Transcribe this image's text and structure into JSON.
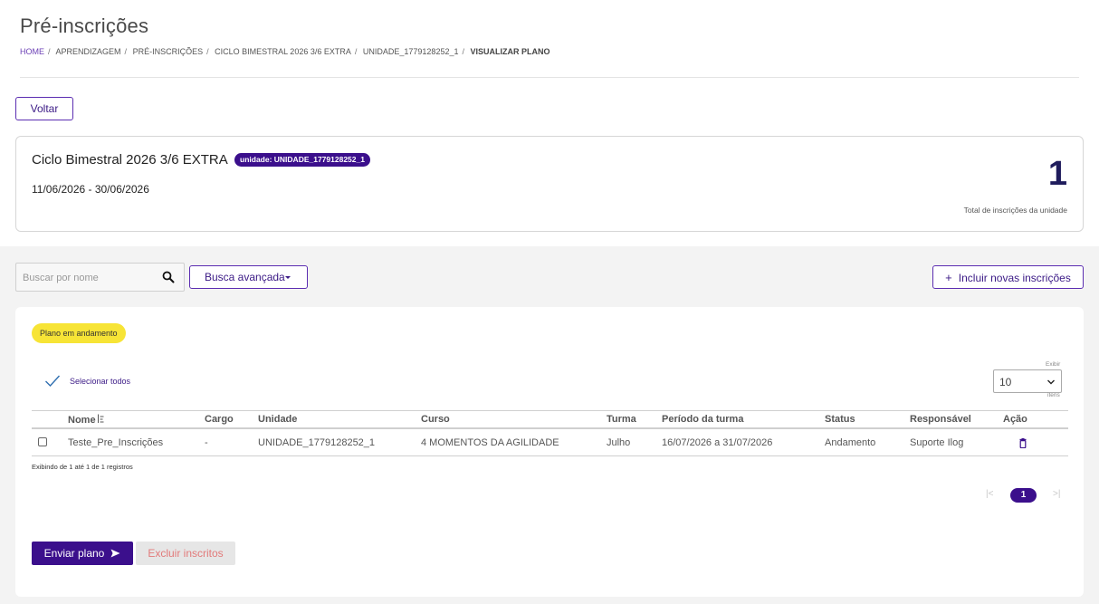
{
  "page": {
    "title": "Pré-inscrições"
  },
  "breadcrumb": [
    {
      "label": "HOME"
    },
    {
      "label": "APRENDIZAGEM"
    },
    {
      "label": "PRÉ-INSCRIÇÕES"
    },
    {
      "label": "CICLO BIMESTRAL 2026 3/6 EXTRA"
    },
    {
      "label": "UNIDADE_1779128252_1"
    },
    {
      "label": "VISUALIZAR PLANO"
    }
  ],
  "back_button": {
    "label": "Voltar"
  },
  "cycle": {
    "title": "Ciclo Bimestral 2026 3/6 EXTRA",
    "unit_badge": "unidade: UNIDADE_1779128252_1",
    "dates": "11/06/2026 - 30/06/2026",
    "total": "1",
    "total_label": "Total de inscrições da unidade"
  },
  "toolbar": {
    "search_placeholder": "Buscar por nome",
    "advanced_search_label": "Busca avançada",
    "add_label": "Incluir novas inscrições",
    "add_icon": "+"
  },
  "plan": {
    "status_badge": "Plano em andamento",
    "select_all_label": "Selecionar todos",
    "page_size_label_top": "Exibir",
    "page_size_value": "10",
    "page_size_label_bottom": "itens"
  },
  "table": {
    "columns": [
      "Nome",
      "Cargo",
      "Unidade",
      "Curso",
      "Turma",
      "Período da turma",
      "Status",
      "Responsável",
      "Ação"
    ],
    "rows": [
      {
        "nome": "Teste_Pre_Inscrições",
        "cargo": "-",
        "unidade": "UNIDADE_1779128252_1",
        "curso": "4 MOMENTOS DA AGILIDADE",
        "turma": "Julho",
        "periodo": "16/07/2026 a 31/07/2026",
        "status": "Andamento",
        "responsavel": "Suporte Ilog",
        "acao_icon": "trash-icon"
      }
    ],
    "records_info": "Exibindo de 1 até 1 de 1 registros"
  },
  "pagination": {
    "first": "|<",
    "current": "1",
    "last": ">|"
  },
  "actions": {
    "send_label": "Enviar plano",
    "delete_label": "Excluir inscritos"
  },
  "colors": {
    "primary": "#3b0f8c",
    "accent_border": "#5b2db1",
    "badge_yellow": "#f7e436",
    "danger_text": "#e27a7a"
  }
}
